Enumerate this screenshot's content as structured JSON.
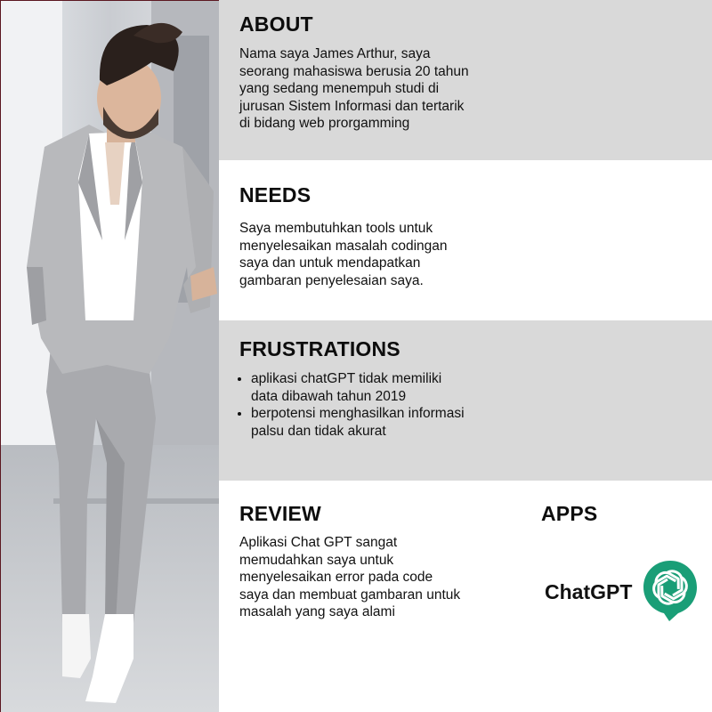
{
  "photo": {
    "alt": "Man in a light gray suit"
  },
  "about": {
    "title": "ABOUT",
    "text": "Nama saya James Arthur, saya seorang mahasiswa berusia 20 tahun yang sedang menempuh studi di jurusan Sistem Informasi dan tertarik di bidang web prorgamming"
  },
  "needs": {
    "title": "NEEDS",
    "text": "Saya membutuhkan tools untuk menyelesaikan masalah codingan saya dan untuk mendapatkan gambaran penyelesaian saya."
  },
  "frustrations": {
    "title": "FRUSTRATIONS",
    "items": [
      "aplikasi chatGPT tidak memiliki data dibawah tahun 2019",
      "berpotensi menghasilkan informasi palsu dan tidak akurat"
    ]
  },
  "review": {
    "title": "REVIEW",
    "text": "Aplikasi Chat GPT sangat memudahkan saya untuk menyelesaikan error pada code saya dan membuat gambaran untuk masalah yang saya alami"
  },
  "apps": {
    "title": "APPS",
    "app_name": "ChatGPT",
    "icon": "openai-logo-icon",
    "icon_color": "#1a9e77"
  },
  "colors": {
    "section_gray": "#d9d9d9",
    "section_white": "#ffffff",
    "accent_border": "#5b1720"
  }
}
